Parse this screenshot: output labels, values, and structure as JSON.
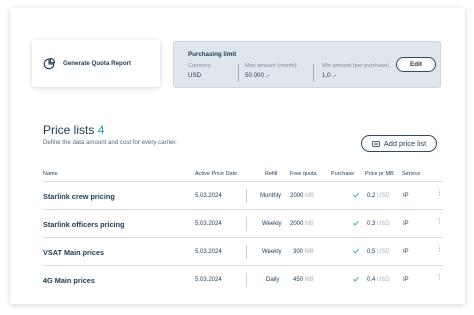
{
  "quota": {
    "label": "Generate Quota Report",
    "icon": "chart-pie-icon"
  },
  "purchasing_limit": {
    "title": "Purchasing limit",
    "currency_label": "Currency",
    "currency_value": "USD",
    "max_label": "Max amount (month)",
    "max_value": "50 000 .-",
    "min_label": "Min amount (per purchase)",
    "min_value": "1,0 .-",
    "edit_label": "Edit"
  },
  "price_lists": {
    "title": "Price lists",
    "count": "4",
    "subtitle": "Define the data amount and cost for every carrier.",
    "add_label": "Add price list",
    "add_icon": "price-list-icon"
  },
  "table": {
    "headers": {
      "name": "Name",
      "active_date": "Active Price Date",
      "refill": "Refill",
      "free_quota": "Free quota",
      "purchase": "Purchase",
      "price_pr_mb": "Price pr MB",
      "service": "Service"
    },
    "rows": [
      {
        "name": "Starlink crew pricing",
        "date": "5.03.2024",
        "refill": "Monthly",
        "quota": "2000",
        "quota_unit": "MB",
        "price": "0,2",
        "price_unit": "USD",
        "service": "IP"
      },
      {
        "name": "Starlink officers pricing",
        "date": "5.03.2024",
        "refill": "Weekly",
        "quota": "2000",
        "quota_unit": "MB",
        "price": "0,3",
        "price_unit": "USD",
        "service": "IP"
      },
      {
        "name": "VSAT Main prices",
        "date": "5.03.2024",
        "refill": "Weekly",
        "quota": "300",
        "quota_unit": "MB",
        "price": "0,5",
        "price_unit": "USD",
        "service": "IP"
      },
      {
        "name": "4G Main prices",
        "date": "5.03.2024",
        "refill": "Daily",
        "quota": "450",
        "quota_unit": "MB",
        "price": "0,4",
        "price_unit": "USD",
        "service": "IP"
      }
    ]
  },
  "colors": {
    "accent": "#1da2a7",
    "text": "#1f3a55",
    "limit_bg": "#dfe6ec"
  }
}
